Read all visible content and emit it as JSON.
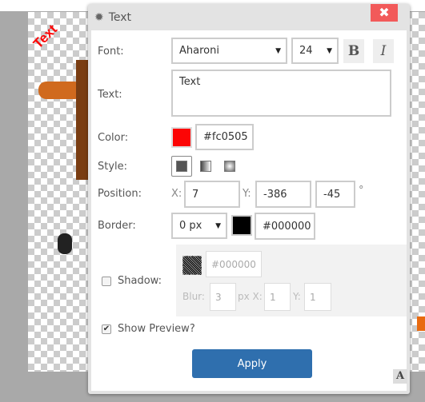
{
  "canvas": {
    "text_object": "Text"
  },
  "dialog": {
    "title": "Text",
    "close_label": "✖",
    "font": {
      "label": "Font:",
      "family": "Aharoni",
      "size": "24",
      "bold": "B",
      "italic": "I"
    },
    "text": {
      "label": "Text:",
      "value": "Text"
    },
    "color": {
      "label": "Color:",
      "swatch": "#fc0505",
      "value": "#fc0505"
    },
    "style": {
      "label": "Style:"
    },
    "position": {
      "label": "Position:",
      "x_label": "X:",
      "x": "7",
      "y_label": "Y:",
      "y": "-386",
      "rotation": "-45",
      "degree": "°"
    },
    "border": {
      "label": "Border:",
      "width": "0 px",
      "swatch": "#000000",
      "value": "#000000"
    },
    "shadow": {
      "label": "Shadow:",
      "checked": false,
      "color": "#000000",
      "blur_label": "Blur:",
      "blur": "3",
      "px_x_label": "px X:",
      "x": "1",
      "y_label": "Y:",
      "y": "1"
    },
    "preview": {
      "label": "Show Preview?",
      "checked": true
    },
    "apply_label": "Apply",
    "corner_icon": "A"
  }
}
